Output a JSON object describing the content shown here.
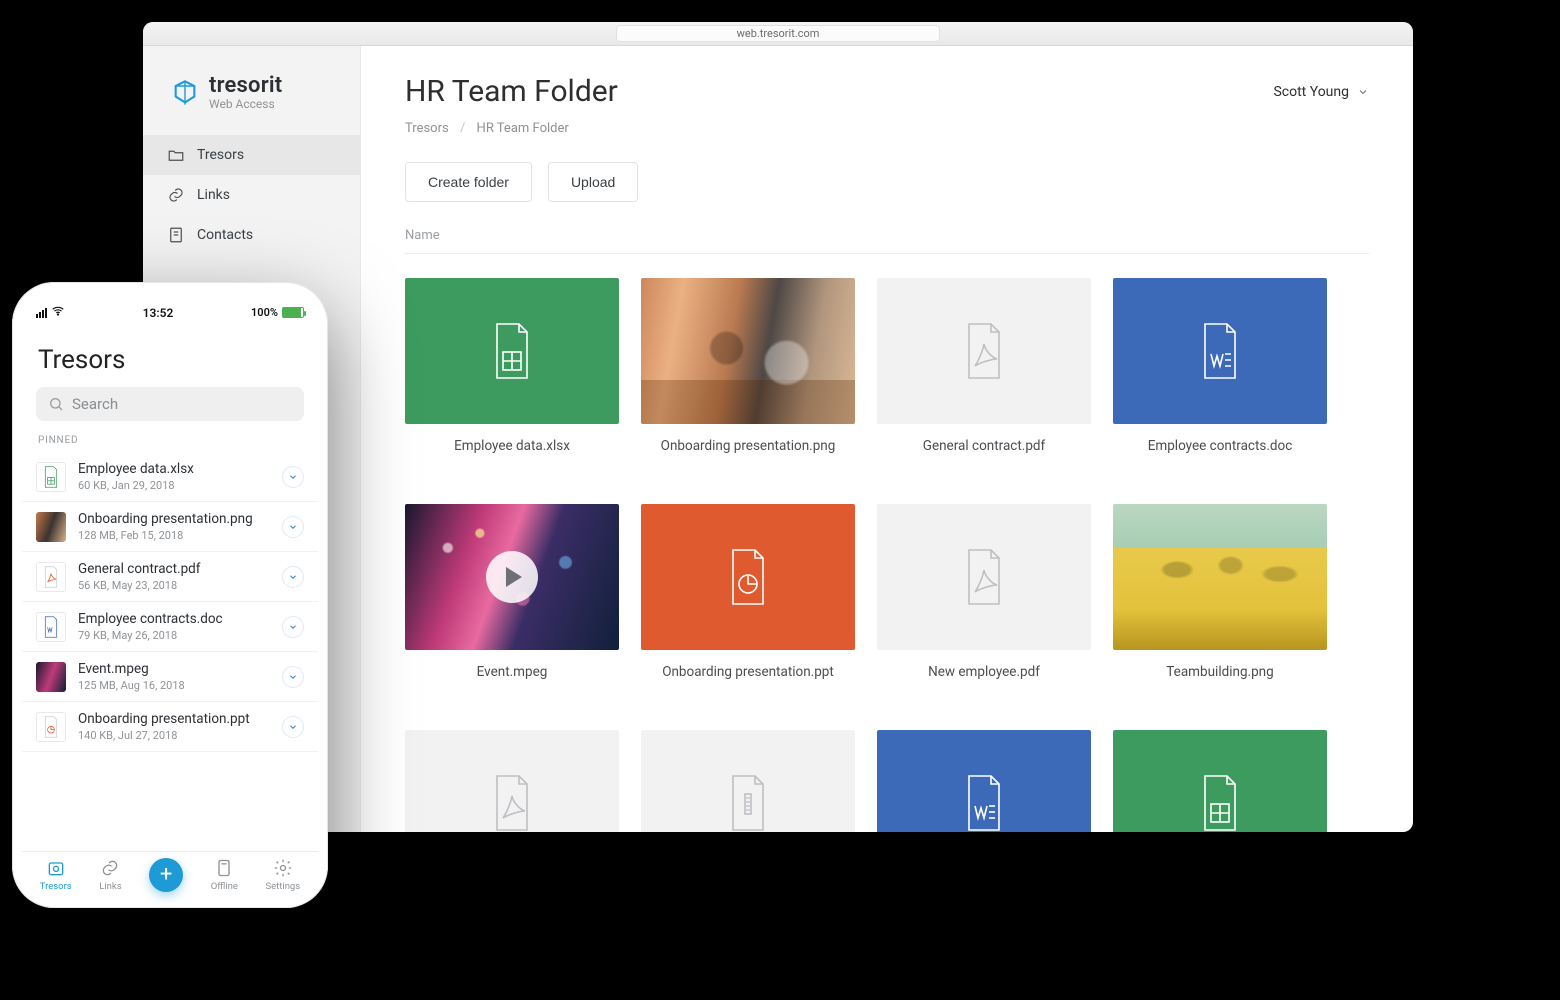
{
  "browser": {
    "url": "web.tresorit.com"
  },
  "brand": {
    "name": "tresorit",
    "sub": "Web Access"
  },
  "sidebar": {
    "items": [
      {
        "label": "Tresors"
      },
      {
        "label": "Links"
      },
      {
        "label": "Contacts"
      }
    ]
  },
  "header": {
    "title": "HR Team Folder",
    "user": "Scott Young"
  },
  "breadcrumb": {
    "root": "Tresors",
    "current": "HR Team Folder"
  },
  "actions": {
    "create_folder": "Create folder",
    "upload": "Upload"
  },
  "list": {
    "name_col": "Name"
  },
  "files": [
    {
      "name": "Employee data.xlsx"
    },
    {
      "name": "Onboarding presentation.png"
    },
    {
      "name": "General contract.pdf"
    },
    {
      "name": "Employee contracts.doc"
    },
    {
      "name": "Event.mpeg"
    },
    {
      "name": "Onboarding presentation.ppt"
    },
    {
      "name": "New employee.pdf"
    },
    {
      "name": "Teambuilding.png"
    }
  ],
  "phone": {
    "status": {
      "time": "13:52",
      "battery": "100%"
    },
    "title": "Tresors",
    "search_placeholder": "Search",
    "section": "PINNED",
    "tabs": {
      "tresors": "Tresors",
      "links": "Links",
      "offline": "Offline",
      "settings": "Settings"
    },
    "items": [
      {
        "name": "Employee data.xlsx",
        "meta": "60 KB, Jan 29, 2018"
      },
      {
        "name": "Onboarding presentation.png",
        "meta": "128 MB, Feb 15, 2018"
      },
      {
        "name": "General contract.pdf",
        "meta": "56 KB, May 23, 2018"
      },
      {
        "name": "Employee contracts.doc",
        "meta": "79 KB, May 26, 2018"
      },
      {
        "name": "Event.mpeg",
        "meta": "125 MB, Aug 16, 2018"
      },
      {
        "name": "Onboarding presentation.ppt",
        "meta": "140 KB, Jul 27, 2018"
      }
    ]
  }
}
